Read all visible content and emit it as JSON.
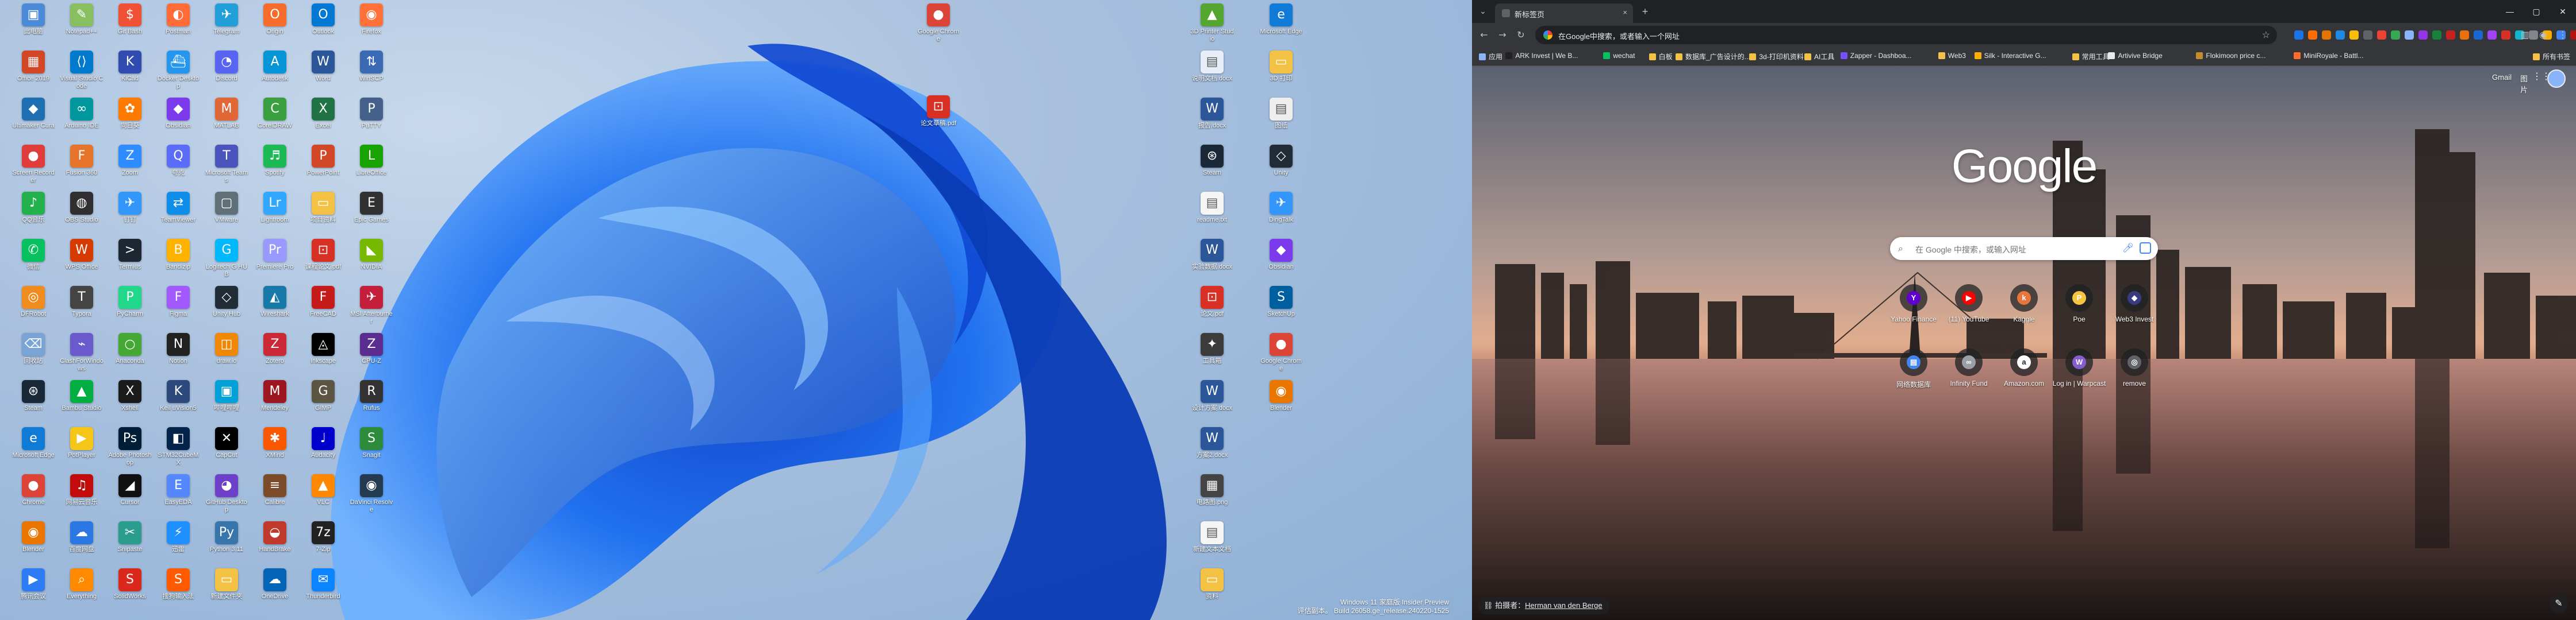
{
  "desktop": {
    "icons": [
      {
        "label": "此电脑",
        "glyph": "▣",
        "color": "#4a8ad8"
      },
      {
        "label": "Office 2019",
        "glyph": "▦",
        "color": "#d24726"
      },
      {
        "label": "Ultimaker Cura",
        "glyph": "◆",
        "color": "#1f6fb3"
      },
      {
        "label": "Screen Recorder",
        "glyph": "●",
        "color": "#e03c3c"
      },
      {
        "label": "QQ音乐",
        "glyph": "♪",
        "color": "#22b14c"
      },
      {
        "label": "微信",
        "glyph": "✆",
        "color": "#07c160"
      },
      {
        "label": "DFRobot",
        "glyph": "◎",
        "color": "#f08c1e"
      },
      {
        "label": "回收站",
        "glyph": "⌫",
        "color": "#7aa4d6"
      },
      {
        "label": "Steam",
        "glyph": "⊛",
        "color": "#1b2838"
      },
      {
        "label": "Microsoft Edge",
        "glyph": "e",
        "color": "#0f7bd7"
      },
      {
        "label": "Chrome",
        "glyph": "●",
        "color": "#db4437"
      },
      {
        "label": "Blender",
        "glyph": "◉",
        "color": "#ea7600"
      },
      {
        "label": "腾讯会议",
        "glyph": "▶",
        "color": "#2d7cf6"
      },
      {
        "label": "Notepad++",
        "glyph": "✎",
        "color": "#88c060"
      },
      {
        "label": "Visual Studio Code",
        "glyph": "⟨⟩",
        "color": "#007acc"
      },
      {
        "label": "Arduino IDE",
        "glyph": "∞",
        "color": "#00979d"
      },
      {
        "label": "Fusion 360",
        "glyph": "F",
        "color": "#e7742b"
      },
      {
        "label": "OBS Studio",
        "glyph": "◍",
        "color": "#302e31"
      },
      {
        "label": "WPS Office",
        "glyph": "W",
        "color": "#d83b01"
      },
      {
        "label": "Typora",
        "glyph": "T",
        "color": "#444444"
      },
      {
        "label": "ClashForWindows",
        "glyph": "⌁",
        "color": "#6a5acd"
      },
      {
        "label": "Bambu Studio",
        "glyph": "▲",
        "color": "#00ae42"
      },
      {
        "label": "PotPlayer",
        "glyph": "▶",
        "color": "#f5c518"
      },
      {
        "label": "网易云音乐",
        "glyph": "♫",
        "color": "#c20c0c"
      },
      {
        "label": "百度网盘",
        "glyph": "☁",
        "color": "#2b78e4"
      },
      {
        "label": "Everything",
        "glyph": "⌕",
        "color": "#ff8a00"
      },
      {
        "label": "Git Bash",
        "glyph": "$",
        "color": "#f05033"
      },
      {
        "label": "KiCad",
        "glyph": "K",
        "color": "#314cb0"
      },
      {
        "label": "向日葵",
        "glyph": "✿",
        "color": "#ff7a00"
      },
      {
        "label": "Zoom",
        "glyph": "Z",
        "color": "#2d8cff"
      },
      {
        "label": "钉钉",
        "glyph": "✈",
        "color": "#3296fa"
      },
      {
        "label": "Termius",
        "glyph": ">",
        "color": "#1d2731"
      },
      {
        "label": "PyCharm",
        "glyph": "P",
        "color": "#21d789"
      },
      {
        "label": "Anaconda",
        "glyph": "○",
        "color": "#44a833"
      },
      {
        "label": "Xshell",
        "glyph": "X",
        "color": "#1b1b1b"
      },
      {
        "label": "Adobe Photoshop",
        "glyph": "Ps",
        "color": "#001e36"
      },
      {
        "label": "Cursor",
        "glyph": "◢",
        "color": "#111111"
      },
      {
        "label": "Snipaste",
        "glyph": "✂",
        "color": "#2a9d8f"
      },
      {
        "label": "SolidWorks",
        "glyph": "S",
        "color": "#da291c"
      },
      {
        "label": "Postman",
        "glyph": "◐",
        "color": "#ff6c37"
      },
      {
        "label": "Docker Desktop",
        "glyph": "⛴",
        "color": "#2496ed"
      },
      {
        "label": "Obsidian",
        "glyph": "◆",
        "color": "#7c3aed"
      },
      {
        "label": "夸克",
        "glyph": "Q",
        "color": "#5b6cf9"
      },
      {
        "label": "TeamViewer",
        "glyph": "⇄",
        "color": "#0e8ee9"
      },
      {
        "label": "Bandizip",
        "glyph": "B",
        "color": "#ffb300"
      },
      {
        "label": "Figma",
        "glyph": "F",
        "color": "#a259ff"
      },
      {
        "label": "Notion",
        "glyph": "N",
        "color": "#222222"
      },
      {
        "label": "Keil uVision5",
        "glyph": "K",
        "color": "#2e4a7d"
      },
      {
        "label": "STM32CubeMX",
        "glyph": "◧",
        "color": "#03234b"
      },
      {
        "label": "EasyEDA",
        "glyph": "E",
        "color": "#5588ff"
      },
      {
        "label": "迅雷",
        "glyph": "⚡",
        "color": "#1e90ff"
      },
      {
        "label": "搜狗输入法",
        "glyph": "S",
        "color": "#ff5a00"
      },
      {
        "label": "Telegram",
        "glyph": "✈",
        "color": "#229ed9"
      },
      {
        "label": "Discord",
        "glyph": "◔",
        "color": "#5865f2"
      },
      {
        "label": "MATLAB",
        "glyph": "M",
        "color": "#e16737"
      },
      {
        "label": "Microsoft Teams",
        "glyph": "T",
        "color": "#4b53bc"
      },
      {
        "label": "VMware",
        "glyph": "▢",
        "color": "#607078"
      },
      {
        "label": "Logitech G HUB",
        "glyph": "G",
        "color": "#00b8fc"
      },
      {
        "label": "Unity Hub",
        "glyph": "◇",
        "color": "#222c37"
      },
      {
        "label": "draw.io",
        "glyph": "◫",
        "color": "#f08705"
      },
      {
        "label": "哔哩哔哩",
        "glyph": "▣",
        "color": "#00a1d6"
      },
      {
        "label": "CapCut",
        "glyph": "✕",
        "color": "#000000"
      },
      {
        "label": "GitHub Desktop",
        "glyph": "◕",
        "color": "#6e40c9"
      },
      {
        "label": "Python 3.11",
        "glyph": "Py",
        "color": "#3776ab"
      },
      {
        "label": "新建文件夹",
        "glyph": "▭",
        "color": "#f3c144"
      },
      {
        "label": "Origin",
        "glyph": "O",
        "color": "#f56c2d"
      },
      {
        "label": "Autodesk",
        "glyph": "A",
        "color": "#0696d7"
      },
      {
        "label": "CorelDRAW",
        "glyph": "C",
        "color": "#3a9f3e"
      },
      {
        "label": "Spotify",
        "glyph": "♬",
        "color": "#1db954"
      },
      {
        "label": "Lightroom",
        "glyph": "Lr",
        "color": "#31a8ff"
      },
      {
        "label": "Premiere Pro",
        "glyph": "Pr",
        "color": "#9999ff"
      },
      {
        "label": "Wireshark",
        "glyph": "◭",
        "color": "#1679a7"
      },
      {
        "label": "Zotero",
        "glyph": "Z",
        "color": "#cc2936"
      },
      {
        "label": "Mendeley",
        "glyph": "M",
        "color": "#9d1620"
      },
      {
        "label": "XMind",
        "glyph": "✱",
        "color": "#f95700"
      },
      {
        "label": "Calibre",
        "glyph": "≡",
        "color": "#7b4b2a"
      },
      {
        "label": "HandBrake",
        "glyph": "◒",
        "color": "#c0392b"
      },
      {
        "label": "OneDrive",
        "glyph": "☁",
        "color": "#0364b8"
      },
      {
        "label": "Outlook",
        "glyph": "O",
        "color": "#0078d4"
      },
      {
        "label": "Word",
        "glyph": "W",
        "color": "#2b579a"
      },
      {
        "label": "Excel",
        "glyph": "X",
        "color": "#217346"
      },
      {
        "label": "PowerPoint",
        "glyph": "P",
        "color": "#d24726"
      },
      {
        "label": "项目资料",
        "glyph": "▭",
        "color": "#f3c144"
      },
      {
        "label": "课程论文.pdf",
        "glyph": "⊡",
        "color": "#d93025"
      },
      {
        "label": "FreeCAD",
        "glyph": "F",
        "color": "#c51b1b"
      },
      {
        "label": "Inkscape",
        "glyph": "◬",
        "color": "#000000"
      },
      {
        "label": "GIMP",
        "glyph": "G",
        "color": "#5c5543"
      },
      {
        "label": "Audacity",
        "glyph": "♩",
        "color": "#0000cc"
      },
      {
        "label": "VLC",
        "glyph": "▲",
        "color": "#ff8800"
      },
      {
        "label": "7-Zip",
        "glyph": "7z",
        "color": "#222222"
      },
      {
        "label": "Thunderbird",
        "glyph": "✉",
        "color": "#0a84ff"
      },
      {
        "label": "Firefox",
        "glyph": "◉",
        "color": "#ff7139"
      },
      {
        "label": "WinSCP",
        "glyph": "⇅",
        "color": "#3b6ab4"
      },
      {
        "label": "PuTTY",
        "glyph": "P",
        "color": "#45608b"
      },
      {
        "label": "LibreOffice",
        "glyph": "L",
        "color": "#18a303"
      },
      {
        "label": "Epic Games",
        "glyph": "E",
        "color": "#313131"
      },
      {
        "label": "NVIDIA",
        "glyph": "◣",
        "color": "#76b900"
      },
      {
        "label": "MSI Afterburner",
        "glyph": "✈",
        "color": "#c41e3a"
      },
      {
        "label": "CPU-Z",
        "glyph": "Z",
        "color": "#5c2d91"
      },
      {
        "label": "Rufus",
        "glyph": "R",
        "color": "#333333"
      },
      {
        "label": "Snagit",
        "glyph": "S",
        "color": "#2c8c3c"
      },
      {
        "label": "DaVinci Resolve",
        "glyph": "◉",
        "color": "#233a51"
      }
    ],
    "right_icons": [
      {
        "label": "3D Printer Studio",
        "glyph": "▲",
        "color": "#55a630"
      },
      {
        "label": "说明文档.docx",
        "glyph": "▤",
        "color": "#e8eef7"
      },
      {
        "label": "报告.docx",
        "glyph": "W",
        "color": "#2b579a"
      },
      {
        "label": "Steam",
        "glyph": "⊛",
        "color": "#1b2838"
      },
      {
        "label": "readme.txt",
        "glyph": "▤",
        "color": "#f5f5f5"
      },
      {
        "label": "实验数据.docx",
        "glyph": "W",
        "color": "#2b579a"
      },
      {
        "label": "论文.pdf",
        "glyph": "⊡",
        "color": "#d93025"
      },
      {
        "label": "工具箱",
        "glyph": "✦",
        "color": "#3b3b3b"
      },
      {
        "label": "设计方案.docx",
        "glyph": "W",
        "color": "#2b579a"
      },
      {
        "label": "方案2.docx",
        "glyph": "W",
        "color": "#2b579a"
      },
      {
        "label": "电路图.png",
        "glyph": "▦",
        "color": "#444444"
      },
      {
        "label": "新建文本文档",
        "glyph": "▤",
        "color": "#f5f5f5"
      },
      {
        "label": "资料",
        "glyph": "▭",
        "color": "#f3c144"
      },
      {
        "label": "Microsoft Edge",
        "glyph": "e",
        "color": "#0f7bd7"
      },
      {
        "label": "3D 打印",
        "glyph": "▭",
        "color": "#f3c144"
      },
      {
        "label": "图纸",
        "glyph": "▤",
        "color": "#eeeeee"
      },
      {
        "label": "Unity",
        "glyph": "◇",
        "color": "#222c37"
      },
      {
        "label": "DingTalk",
        "glyph": "✈",
        "color": "#3296fa"
      },
      {
        "label": "Obsidian",
        "glyph": "◆",
        "color": "#7c3aed"
      },
      {
        "label": "SketchUp",
        "glyph": "S",
        "color": "#005f9e"
      },
      {
        "label": "Google Chrome",
        "glyph": "●",
        "color": "#db4437"
      },
      {
        "label": "Blender",
        "glyph": "◉",
        "color": "#ea7600"
      }
    ],
    "center_icons": [
      {
        "label": "Google Chrome",
        "glyph": "●",
        "color": "#db4437"
      },
      {
        "label": "论文草稿.pdf",
        "glyph": "⊡",
        "color": "#d93025"
      }
    ],
    "watermark": {
      "line1": "Windows 11 家庭版 Insider Preview",
      "line2": "评估副本。 Build 26058.ge_release.240220-1525"
    }
  },
  "browser": {
    "tab": {
      "title": "新标签页",
      "close": "×"
    },
    "new_tab": "+",
    "window": {
      "min": "—",
      "max": "▢",
      "close": "✕"
    },
    "omnibox": {
      "placeholder": "在Google中搜索，或者输入一个网址",
      "star": "☆"
    },
    "bookmarks": [
      {
        "label": "应用",
        "color": "#8ab4f8"
      },
      {
        "label": "ARK Invest | We B...",
        "color": "#222222"
      },
      {
        "label": "wechat",
        "color": "#07c160"
      },
      {
        "label": "白板",
        "color": "#f3c144"
      },
      {
        "label": "数据库_广告设计的...",
        "color": "#f3c144"
      },
      {
        "label": "3d-打印机资料",
        "color": "#f3c144"
      },
      {
        "label": "AI工具",
        "color": "#f3c144"
      },
      {
        "label": "Zapper - Dashboa...",
        "color": "#784ffe"
      },
      {
        "label": "Web3",
        "color": "#f3c144"
      },
      {
        "label": "Silk - Interactive G...",
        "color": "#ffb000"
      },
      {
        "label": "常用工具",
        "color": "#f3c144"
      },
      {
        "label": "Artivive Bridge",
        "color": "#e8eaed"
      },
      {
        "label": "Flokimoon price c...",
        "color": "#c58b2a"
      },
      {
        "label": "MiniRoyale - Battl...",
        "color": "#ff6b2b"
      }
    ],
    "all_bookmarks": "所有书签",
    "ntp": {
      "gmail": "Gmail",
      "images": "图片",
      "logo": "Google",
      "search_placeholder": "在 Google 中搜索，或输入网址",
      "shortcuts": [
        {
          "title": "Yahoo Finance",
          "letter": "Y",
          "color": "#6001d2"
        },
        {
          "title": "(11) YouTube",
          "letter": "▶",
          "color": "#ff0000"
        },
        {
          "title": "Kaggle",
          "letter": "k",
          "color": "#e8753c"
        },
        {
          "title": "Poe",
          "letter": "P",
          "color": "#f5c542"
        },
        {
          "title": "Web3 Invest",
          "letter": "◆",
          "color": "#3a3a80"
        },
        {
          "title": "网络数据库",
          "letter": "▤",
          "color": "#4285f4"
        },
        {
          "title": "Infinity Fund",
          "letter": "∞",
          "color": "#9aa0a6"
        },
        {
          "title": "Amazon.com",
          "letter": "a",
          "color": "#ffffff"
        },
        {
          "title": "Log in | Warpcast",
          "letter": "W",
          "color": "#855dcd"
        },
        {
          "title": "remove",
          "letter": "◎",
          "color": "#5f6368"
        }
      ],
      "credit_prefix": "拍摄者：",
      "credit_author": "Herman van den Berge",
      "customize": "✎"
    }
  }
}
